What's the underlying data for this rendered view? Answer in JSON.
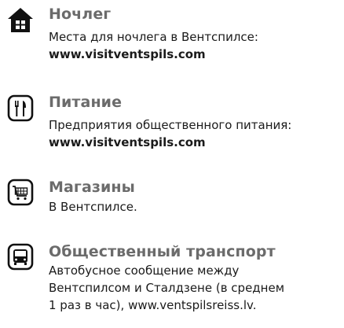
{
  "colors": {
    "title": "#6b6b6b",
    "text": "#1a1a1a",
    "icon": "#111111"
  },
  "sections": [
    {
      "icon": "house-icon",
      "title": "Ночлег",
      "text": "Места для ночлега в Вентспилсе:",
      "link": "www.visitventspils.com"
    },
    {
      "icon": "fork-knife-icon",
      "title": "Питание",
      "text": "Предприятия общественного питания:",
      "link": "www.visitventspils.com"
    },
    {
      "icon": "shopping-cart-icon",
      "title": "Магазины",
      "text": "В Вентспилсе."
    },
    {
      "icon": "bus-icon",
      "title": "Общественный транспорт",
      "lines": [
        "Автобусное сообщение между",
        "Вентспилсом и Сталдзене (в среднем",
        "1 раз в час), www.ventspilsreiss.lv."
      ]
    }
  ]
}
